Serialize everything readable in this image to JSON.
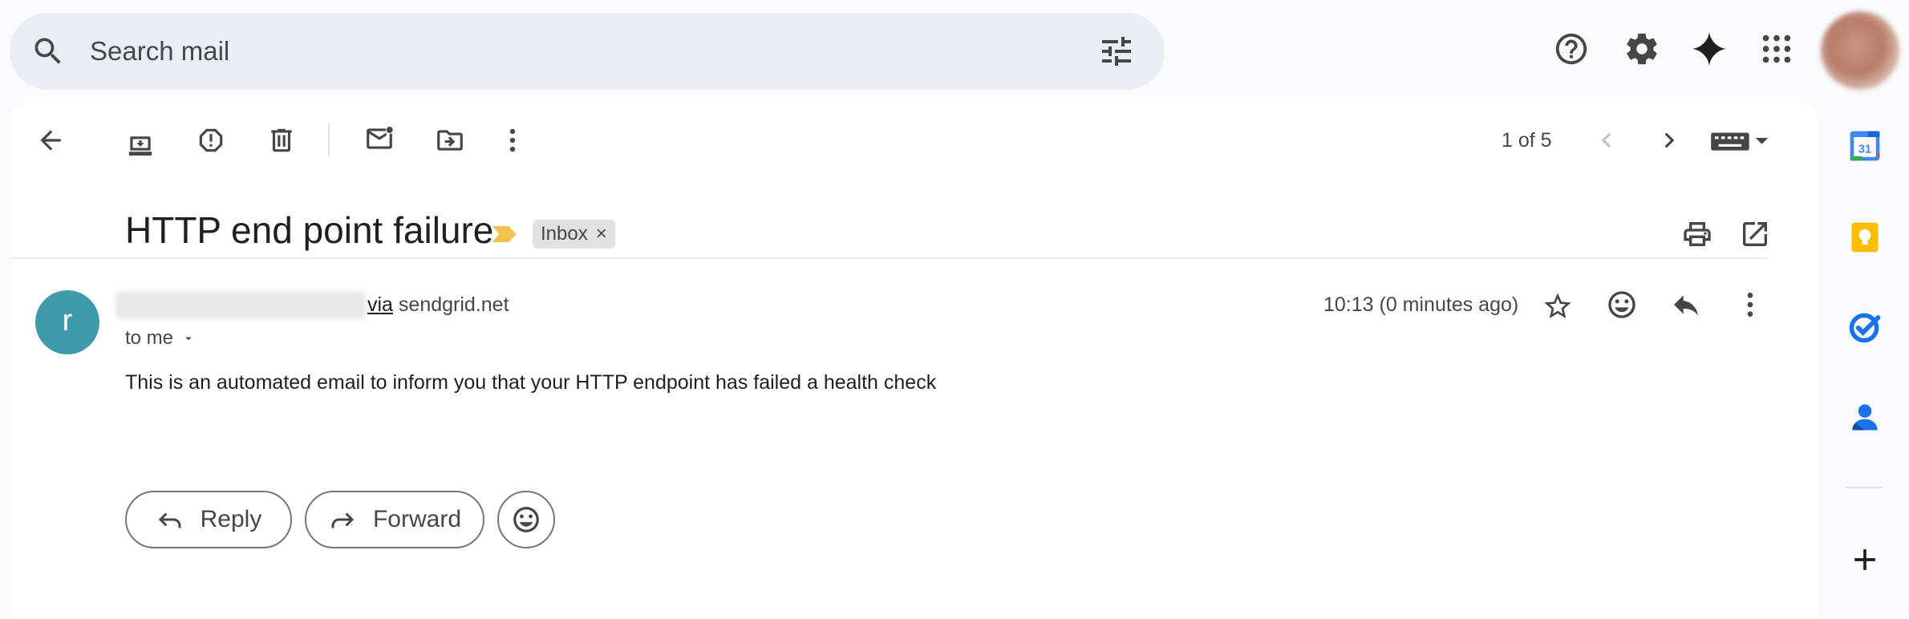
{
  "search": {
    "placeholder": "Search mail"
  },
  "topbar": {
    "icons": [
      "support-icon",
      "settings-icon",
      "gemini-icon",
      "apps-grid-icon"
    ],
    "account_avatar": "account-avatar"
  },
  "toolbar": {
    "icons": [
      "back-arrow-icon",
      "archive-icon",
      "report-spam-icon",
      "delete-icon",
      "mark-unread-icon",
      "move-to-icon",
      "more-vert-icon"
    ],
    "pager": "1 of 5"
  },
  "email": {
    "subject": "HTTP end point failure",
    "label": "Inbox",
    "label_remove": "×",
    "sender_initial": "r",
    "via_text": "via",
    "via_domain": "sendgrid.net",
    "recipient": "to me",
    "timestamp": "10:13 (0 minutes ago)",
    "body": "This is an automated email to inform you that your HTTP endpoint has failed a health check"
  },
  "actions": {
    "reply_label": "Reply",
    "forward_label": "Forward"
  },
  "side_panel": {
    "calendar_day": "31",
    "apps": [
      "calendar-icon",
      "keep-icon",
      "tasks-icon",
      "contacts-icon",
      "add-addon-icon"
    ]
  },
  "colors": {
    "background": "#f8fafd",
    "search_bg": "#e9eef6",
    "avatar": "#3f9bac",
    "importance_marker": "#f2c14e",
    "label_chip": "#dfe1e5"
  }
}
